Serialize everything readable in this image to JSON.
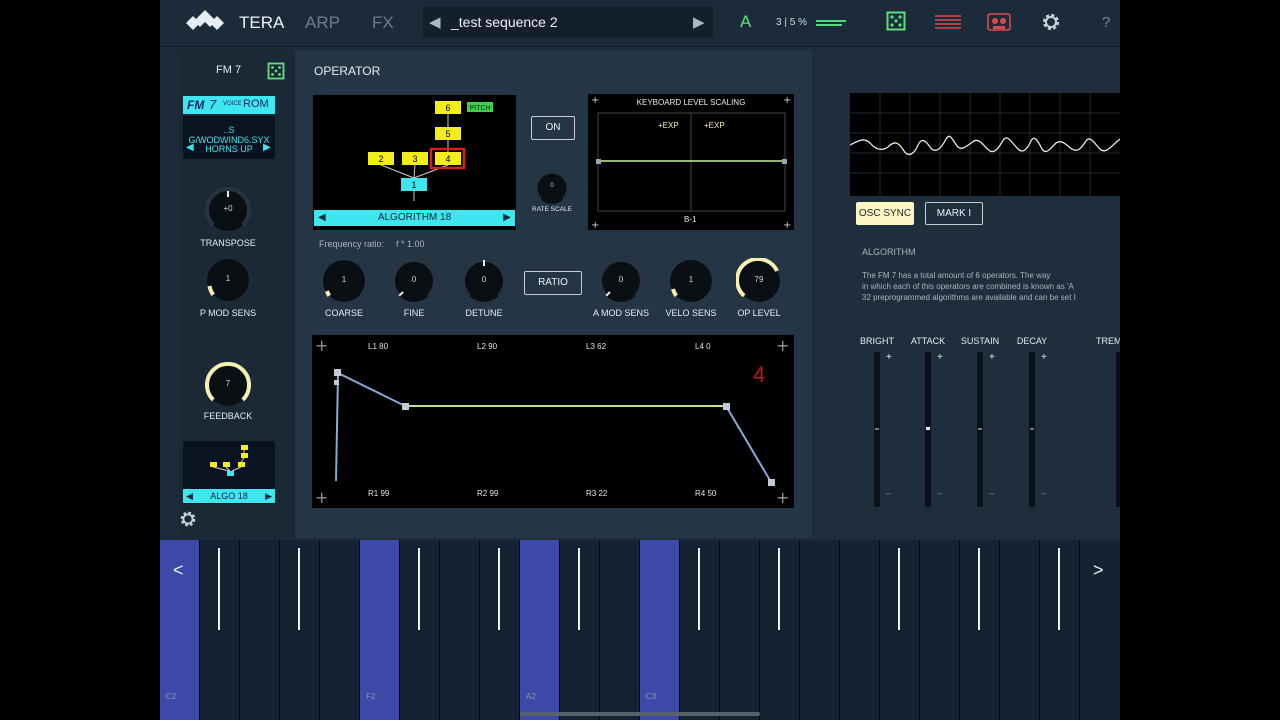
{
  "header": {
    "app_name": "TERA",
    "tabs": [
      "ARP",
      "FX"
    ],
    "sequence_name": "_test sequence 2",
    "ab_label": "A",
    "cpu_text": "3 | 5 %",
    "help_label": "?",
    "icons": [
      "tera-logo-icon",
      "prev-arrow-icon",
      "next-arrow-icon",
      "dice-icon",
      "lines-icon",
      "tape-icon",
      "gear-icon"
    ]
  },
  "left": {
    "title": "FM 7",
    "rom_logo_fm": "FM",
    "rom_logo_seven": "7",
    "rom_logo_voice": "VOICE",
    "rom_logo_rom": "ROM",
    "file_name": "..S G/WODWIND6.SYX",
    "preset_name": "HORNS UP",
    "transpose_label": "TRANSPOSE",
    "transpose_value": "+0",
    "pmod_label": "P MOD SENS",
    "pmod_value": "1",
    "feedback_label": "FEEDBACK",
    "feedback_value": "7",
    "algo_label": "ALGO 18"
  },
  "operator": {
    "title": "OPERATOR",
    "algorithm_label": "ALGORITHM 18",
    "pitch_label": "PITCH",
    "ops": [
      "1",
      "2",
      "3",
      "4",
      "5",
      "6"
    ],
    "on_label": "ON",
    "rate_scale_label": "RATE SCALE",
    "rate_scale_value": "0",
    "kls_title": "KEYBOARD LEVEL SCALING",
    "kls_left_curve": "+EXP",
    "kls_right_curve": "+EXP",
    "kls_break_point": "B-1",
    "freq_label": "Frequency ratio:",
    "freq_value": "f * 1.00",
    "ratio_label": "RATIO",
    "knobs": [
      {
        "label": "COARSE",
        "value": "1"
      },
      {
        "label": "FINE",
        "value": "0"
      },
      {
        "label": "DETUNE",
        "value": "0"
      },
      {
        "label": "A MOD SENS",
        "value": "0"
      },
      {
        "label": "VELO SENS",
        "value": "1"
      },
      {
        "label": "OP LEVEL",
        "value": "79"
      }
    ],
    "envelope": {
      "levels": [
        "L1  80",
        "L2  90",
        "L3  62",
        "L4  0"
      ],
      "rates": [
        "R1  99",
        "R2  99",
        "R3  22",
        "R4  50"
      ],
      "op_number": "4"
    }
  },
  "right": {
    "osc_sync_label": "OSC SYNC",
    "mark_label": "MARK I",
    "section_title": "ALGORITHM",
    "description": [
      "The FM 7 has a total amount of 6 operators. The way",
      "in which each of this operators are combined is known as 'A",
      "32 preprogrammed algorithms are available and can be set I"
    ],
    "faders": [
      "BRIGHT",
      "ATTACK",
      "SUSTAIN",
      "DECAY",
      "TREM"
    ],
    "plus": "+",
    "minus": "–"
  },
  "keyboard": {
    "left_arrow": "<",
    "right_arrow": ">",
    "note_labels": [
      "C2",
      "F2",
      "A2",
      "C3"
    ]
  },
  "colors": {
    "accent_cyan": "#3ee6f0",
    "op_yellow": "#f2ee1e",
    "env_green": "#b8e68c",
    "key_blue": "#3d49a8"
  }
}
